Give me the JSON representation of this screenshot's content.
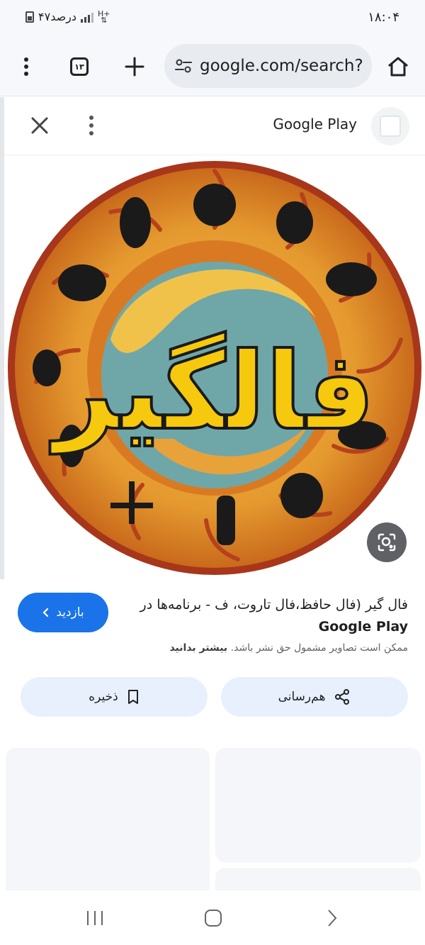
{
  "status_bar": {
    "time": "۱۸:۰۴",
    "battery_text": "۴۷درصد",
    "network": "H+"
  },
  "toolbar": {
    "url": "google.com/search?",
    "tab_count": "۱۳"
  },
  "sheet": {
    "source_name": "Google Play"
  },
  "image": {
    "logo_text": "فالگیر"
  },
  "result": {
    "title": "فال گیر (فال حافظ،فال تاروت، ف - برنامه‌ها در",
    "title_source": "Google Play",
    "notice": "ممکن است تصاویر مشمول حق نشر باشد.",
    "learn_more": "بیشتر بدانید",
    "visit_label": "بازدید"
  },
  "actions": {
    "share_label": "هم‌رسانی",
    "save_label": "ذخیره"
  },
  "colors": {
    "accent": "#1a73e8",
    "pill_bg": "#e8f0fe",
    "logo_yellow": "#f6c90e"
  }
}
